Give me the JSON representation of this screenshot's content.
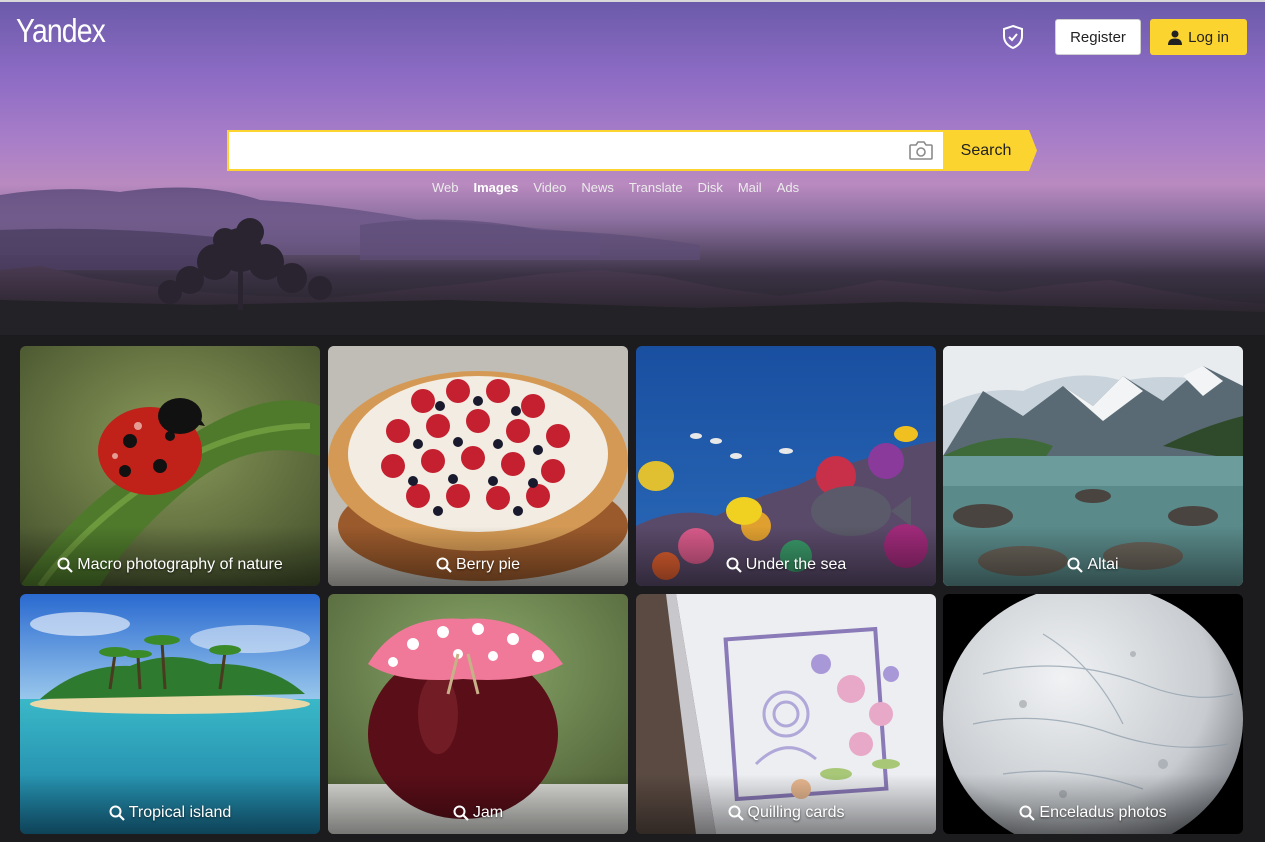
{
  "header": {
    "logo": "Yandex",
    "register_label": "Register",
    "login_label": "Log in"
  },
  "search": {
    "value": "",
    "placeholder": "",
    "button_label": "Search"
  },
  "services": [
    {
      "label": "Web",
      "active": false
    },
    {
      "label": "Images",
      "active": true
    },
    {
      "label": "Video",
      "active": false
    },
    {
      "label": "News",
      "active": false
    },
    {
      "label": "Translate",
      "active": false
    },
    {
      "label": "Disk",
      "active": false
    },
    {
      "label": "Mail",
      "active": false
    },
    {
      "label": "Ads",
      "active": false
    }
  ],
  "cards": [
    {
      "label": "Macro photography of nature"
    },
    {
      "label": "Berry pie"
    },
    {
      "label": "Under the sea"
    },
    {
      "label": "Altai"
    },
    {
      "label": "Tropical island"
    },
    {
      "label": "Jam"
    },
    {
      "label": "Quilling cards"
    },
    {
      "label": "Enceladus photos"
    }
  ],
  "colors": {
    "accent": "#fcd430",
    "page_bg": "#1c1c1e",
    "sky": "#8c6bc4"
  },
  "icons": [
    "shield-icon",
    "user-icon",
    "camera-icon",
    "magnifier-icon"
  ]
}
